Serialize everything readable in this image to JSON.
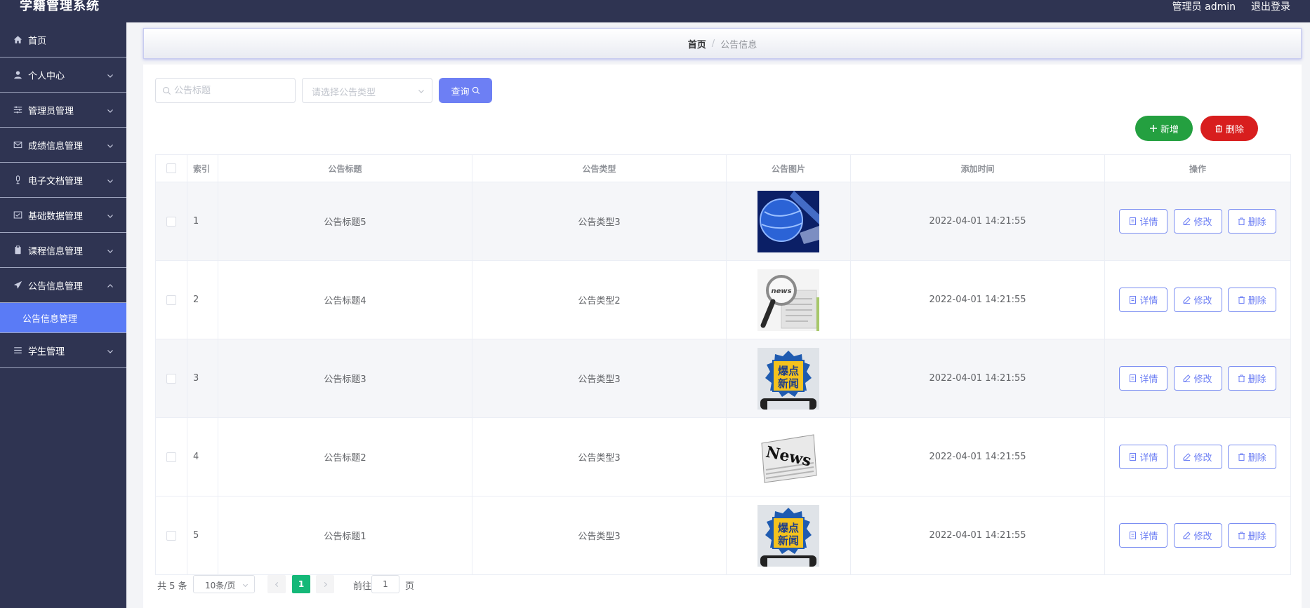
{
  "app": {
    "title": "学籍管理系统",
    "user_label": "管理员 admin",
    "logout_label": "退出登录"
  },
  "sidebar": {
    "items": [
      {
        "label": "首页",
        "icon": "home-icon",
        "has_arrow": false
      },
      {
        "label": "个人中心",
        "icon": "user-icon",
        "has_arrow": true
      },
      {
        "label": "管理员管理",
        "icon": "sliders-icon",
        "has_arrow": true
      },
      {
        "label": "成绩信息管理",
        "icon": "mail-icon",
        "has_arrow": true
      },
      {
        "label": "电子文档管理",
        "icon": "microphone-icon",
        "has_arrow": true
      },
      {
        "label": "基础数据管理",
        "icon": "message-box-icon",
        "has_arrow": true
      },
      {
        "label": "课程信息管理",
        "icon": "clipboard-icon",
        "has_arrow": true
      },
      {
        "label": "公告信息管理",
        "icon": "send-icon",
        "has_arrow": true,
        "expanded": true
      },
      {
        "label": "学生管理",
        "icon": "list-icon",
        "has_arrow": true
      }
    ],
    "sub_item": "公告信息管理"
  },
  "breadcrumb": {
    "home": "首页",
    "separator": "/",
    "current": "公告信息"
  },
  "search": {
    "title_placeholder": "公告标题",
    "type_placeholder": "请选择公告类型",
    "query_label": "查询"
  },
  "actions": {
    "add_label": "新增",
    "delete_label": "删除"
  },
  "table": {
    "headers": {
      "index": "索引",
      "title": "公告标题",
      "type": "公告类型",
      "image": "公告图片",
      "time": "添加时间",
      "ops": "操作"
    },
    "rows": [
      {
        "index": "1",
        "title": "公告标题5",
        "type": "公告类型3",
        "image": "globe-news-image",
        "time": "2022-04-01 14:21:55"
      },
      {
        "index": "2",
        "title": "公告标题4",
        "type": "公告类型2",
        "image": "magnifier-news-image",
        "time": "2022-04-01 14:21:55"
      },
      {
        "index": "3",
        "title": "公告标题3",
        "type": "公告类型3",
        "image": "breaking-news-image",
        "time": "2022-04-01 14:21:55"
      },
      {
        "index": "4",
        "title": "公告标题2",
        "type": "公告类型3",
        "image": "newspaper-image",
        "time": "2022-04-01 14:21:55"
      },
      {
        "index": "5",
        "title": "公告标题1",
        "type": "公告类型3",
        "image": "breaking-news-image",
        "time": "2022-04-01 14:21:55"
      }
    ],
    "ops": {
      "detail": "详情",
      "edit": "修改",
      "delete": "删除"
    },
    "image_texts": {
      "breaking": [
        "爆点",
        "新闻"
      ],
      "news": "News",
      "news_small": "news"
    }
  },
  "pagination": {
    "total": "共 5 条",
    "page_size": "10条/页",
    "current_page": "1",
    "goto_label": "前往",
    "goto_value": "1",
    "page_suffix": "页"
  },
  "colors": {
    "sidebar_bg": "#2f3452",
    "accent": "#6d7ff4",
    "active_menu": "#5a7bf6",
    "add_green": "#24a040",
    "delete_red": "#d81e1e",
    "page_active": "#14b878"
  }
}
